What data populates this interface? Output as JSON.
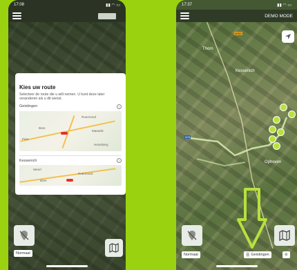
{
  "left_screen": {
    "status_time": "17:08",
    "dialog": {
      "title": "Kies uw route",
      "description": "Selecteer de route die u wilt nemen. U kunt deze later veranderen als u dit wenst.",
      "routes": [
        {
          "name": "Geistingen",
          "map_labels": [
            "Roermond",
            "Bree",
            "Maaseik",
            "Heinsberg",
            "Peer"
          ]
        },
        {
          "name": "Kessenich",
          "map_labels": [
            "Weert",
            "Roermond",
            "Bree"
          ]
        }
      ]
    },
    "chip_label": "Normaal",
    "icons": {
      "location_off": "location-off-icon",
      "map": "map-icon"
    }
  },
  "right_screen": {
    "status_time": "17:37",
    "header_title": "DEMO MODE",
    "map_labels": [
      "Thorn",
      "Kessenich",
      "Ophoven"
    ],
    "road_badges": [
      "N78",
      "N762"
    ],
    "chip_normal": "Normaal",
    "chip_route": "Geistingen",
    "arrow_color": "#b8e13c",
    "accent": "#9bd20f"
  }
}
